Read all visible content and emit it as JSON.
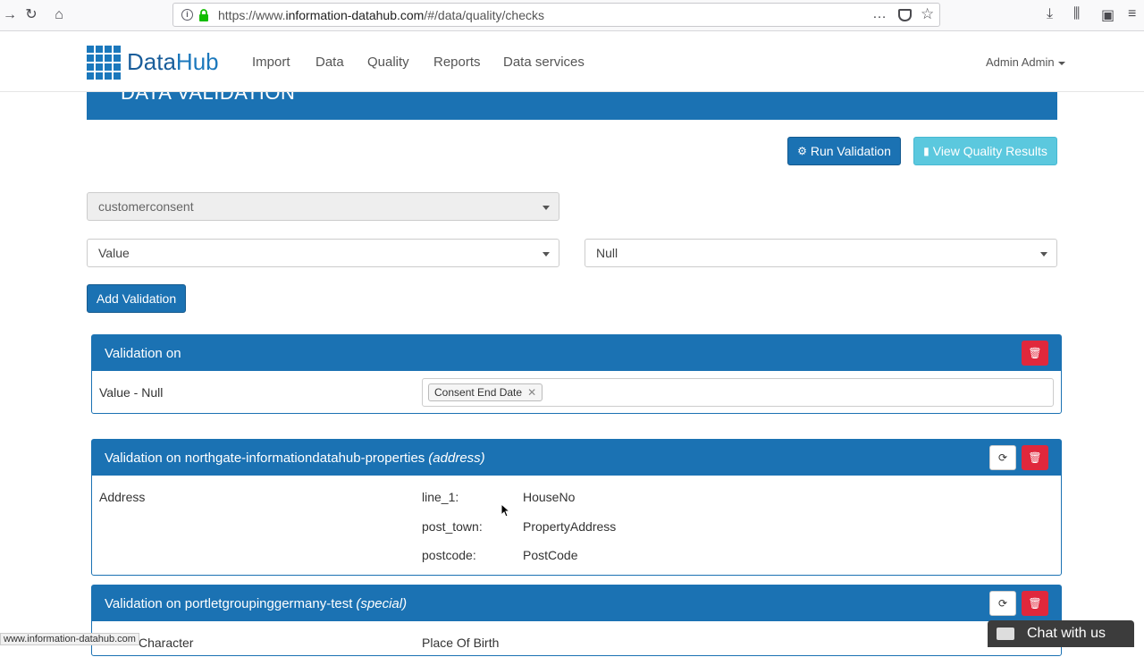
{
  "browser": {
    "url_prefix": "https://www.",
    "url_domain": "information-datahub.com",
    "url_path": "/#/data/quality/checks",
    "more_icon": "…",
    "status_url": "www.information-datahub.com"
  },
  "header": {
    "logo_data": "Data",
    "logo_hub": "Hub",
    "nav": [
      "Import",
      "Data",
      "Quality",
      "Reports",
      "Data services"
    ],
    "user": "Admin Admin"
  },
  "page": {
    "title": "DATA VALIDATION",
    "run_validation": "Run Validation",
    "view_results": "View Quality Results",
    "entity_select": "customerconsent",
    "type_select": "Value",
    "rule_select": "Null",
    "add_validation": "Add Validation"
  },
  "panels": [
    {
      "title": "Validation on",
      "row_label": "Value - Null",
      "tag": "Consent End Date"
    },
    {
      "title": "Validation on northgate-informationdatahub-properties",
      "title_suffix": "(address)",
      "row_label": "Address",
      "mappings": [
        {
          "key": "line_1:",
          "value": "HouseNo"
        },
        {
          "key": "post_town:",
          "value": "PropertyAddress"
        },
        {
          "key": "postcode:",
          "value": "PostCode"
        }
      ]
    },
    {
      "title": "Validation on portletgroupinggermany-test",
      "title_suffix": "(special)",
      "row_label": "Character",
      "field": "Place Of Birth"
    }
  ],
  "chat": {
    "label": "Chat with us"
  },
  "colors": {
    "primary": "#1b72b3",
    "info": "#5bc8de",
    "danger": "#e0283c"
  }
}
